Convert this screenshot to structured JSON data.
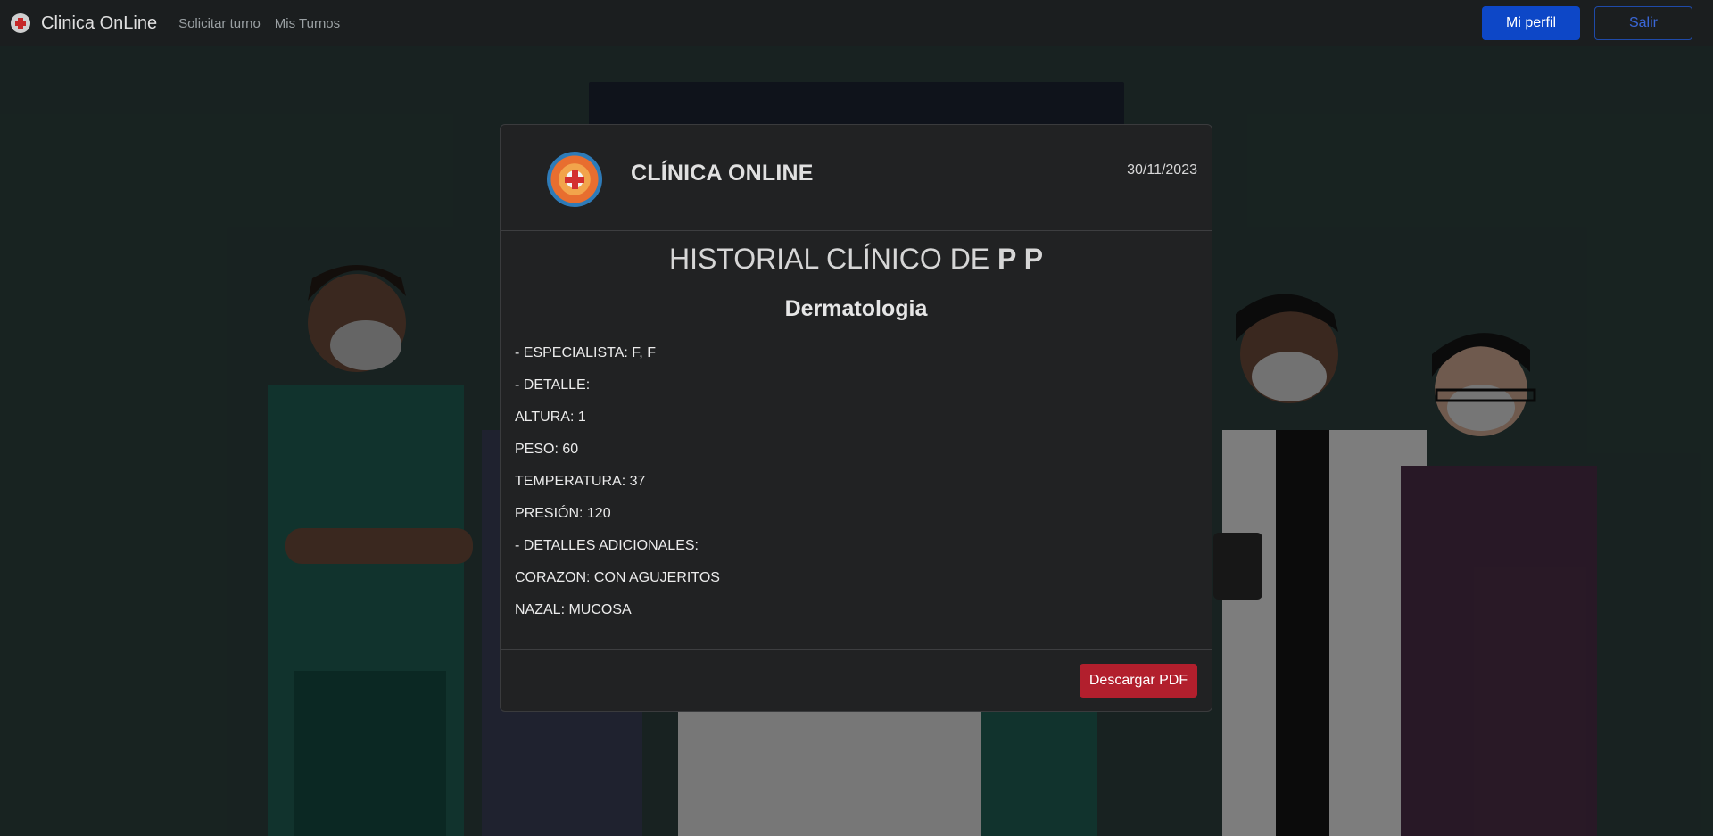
{
  "navbar": {
    "brand": "Clinica OnLine",
    "links": [
      "Solicitar turno",
      "Mis Turnos"
    ],
    "profile_button": "Mi perfil",
    "logout_button": "Salir"
  },
  "modal": {
    "clinic_name": "CLÍNICA ONLINE",
    "date": "30/11/2023",
    "title_prefix": "HISTORIAL CLÍNICO DE ",
    "patient_name": "P P",
    "specialty": "Dermatologia",
    "lines": [
      "- ESPECIALISTA: F, F",
      "- DETALLE:",
      "ALTURA: 1",
      "PESO: 60",
      "TEMPERATURA: 37",
      "PRESIÓN: 120",
      "- DETALLES ADICIONALES:",
      "CORAZON: CON AGUJERITOS",
      "NAZAL: MUCOSA"
    ],
    "download_button": "Descargar PDF"
  },
  "colors": {
    "navbar_bg": "#1b1e1f",
    "primary": "#0d47c7",
    "danger": "#b21f2d",
    "modal_bg": "#212223"
  }
}
